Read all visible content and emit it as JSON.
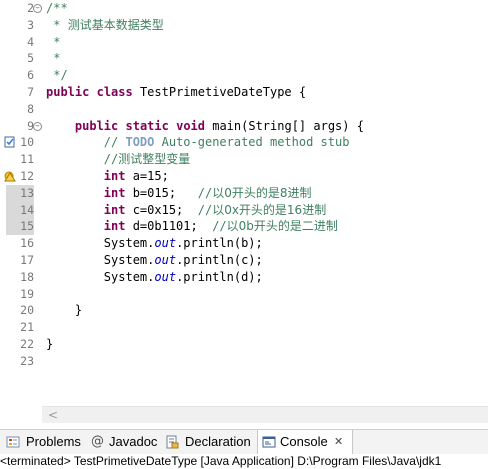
{
  "editor": {
    "lines": [
      {
        "no": "2",
        "fold": "−",
        "segs": [
          {
            "t": "/**",
            "c": "cm"
          }
        ]
      },
      {
        "no": "3",
        "segs": [
          {
            "t": " * ",
            "c": "cm"
          },
          {
            "t": "测试基本数据类型",
            "c": "cm cn"
          }
        ]
      },
      {
        "no": "4",
        "segs": [
          {
            "t": " *",
            "c": "cm"
          }
        ]
      },
      {
        "no": "5",
        "segs": [
          {
            "t": " *",
            "c": "cm"
          }
        ]
      },
      {
        "no": "6",
        "segs": [
          {
            "t": " */",
            "c": "cm"
          }
        ]
      },
      {
        "no": "7",
        "segs": [
          {
            "t": "public",
            "c": "kw"
          },
          {
            "t": " "
          },
          {
            "t": "class",
            "c": "kw"
          },
          {
            "t": " TestPrimetiveDateType {"
          }
        ]
      },
      {
        "no": "8",
        "segs": []
      },
      {
        "no": "9",
        "fold": "−",
        "segs": [
          {
            "t": "    "
          },
          {
            "t": "public",
            "c": "kw"
          },
          {
            "t": " "
          },
          {
            "t": "static",
            "c": "kw"
          },
          {
            "t": " "
          },
          {
            "t": "void",
            "c": "kw"
          },
          {
            "t": " main(String[] "
          },
          {
            "t": "args",
            "c": "plain"
          },
          {
            "t": ") {"
          }
        ]
      },
      {
        "no": "10",
        "marker": "task",
        "segs": [
          {
            "t": "        "
          },
          {
            "t": "// ",
            "c": "cm"
          },
          {
            "t": "TODO",
            "c": "todo"
          },
          {
            "t": " Auto-generated method stub",
            "c": "cm"
          }
        ]
      },
      {
        "no": "11",
        "segs": [
          {
            "t": "        "
          },
          {
            "t": "//",
            "c": "cm"
          },
          {
            "t": "测试整型变量",
            "c": "cm cn"
          }
        ]
      },
      {
        "no": "12",
        "marker": "warn",
        "segs": [
          {
            "t": "        "
          },
          {
            "t": "int",
            "c": "kw"
          },
          {
            "t": " a=15;"
          }
        ]
      },
      {
        "no": "13",
        "hl": true,
        "segs": [
          {
            "t": "        "
          },
          {
            "t": "int",
            "c": "kw"
          },
          {
            "t": " b=015;   "
          },
          {
            "t": "//",
            "c": "cm"
          },
          {
            "t": "以0开头的是8进制",
            "c": "cm cn"
          }
        ]
      },
      {
        "no": "14",
        "hl": true,
        "segs": [
          {
            "t": "        "
          },
          {
            "t": "int",
            "c": "kw"
          },
          {
            "t": " c=0x15;  "
          },
          {
            "t": "//",
            "c": "cm"
          },
          {
            "t": "以0x开头的是16进制",
            "c": "cm cn"
          }
        ]
      },
      {
        "no": "15",
        "hl": true,
        "segs": [
          {
            "t": "        "
          },
          {
            "t": "int",
            "c": "kw"
          },
          {
            "t": " d=0b1101;  "
          },
          {
            "t": "//",
            "c": "cm"
          },
          {
            "t": "以0b开头的是二进制",
            "c": "cm cn"
          }
        ]
      },
      {
        "no": "16",
        "segs": [
          {
            "t": "        System."
          },
          {
            "t": "out",
            "c": "fld"
          },
          {
            "t": ".println(b);"
          }
        ]
      },
      {
        "no": "17",
        "segs": [
          {
            "t": "        System."
          },
          {
            "t": "out",
            "c": "fld"
          },
          {
            "t": ".println(c);"
          }
        ]
      },
      {
        "no": "18",
        "segs": [
          {
            "t": "        System."
          },
          {
            "t": "out",
            "c": "fld"
          },
          {
            "t": ".println(d);"
          }
        ]
      },
      {
        "no": "19",
        "segs": []
      },
      {
        "no": "20",
        "segs": [
          {
            "t": "    }"
          }
        ]
      },
      {
        "no": "21",
        "segs": []
      },
      {
        "no": "22",
        "segs": [
          {
            "t": "}"
          }
        ]
      },
      {
        "no": "23",
        "segs": []
      }
    ],
    "scroll_left_arrow": "<"
  },
  "tabs": [
    {
      "label": "Problems",
      "icon": "problems-icon",
      "close": ""
    },
    {
      "label": "Javadoc",
      "icon": "at-icon",
      "close": ""
    },
    {
      "label": "Declaration",
      "icon": "declaration-icon",
      "close": ""
    },
    {
      "label": "Console",
      "icon": "console-icon",
      "close": "✕",
      "active": true
    }
  ],
  "status": {
    "text": "<terminated> TestPrimetiveDateType [Java Application] D:\\Program Files\\Java\\jdk1"
  },
  "colors": {
    "keyword": "#7f0055",
    "comment": "#3f7f5f",
    "todo": "#7f9fbf",
    "field": "#0000c0",
    "line_number": "#787878"
  }
}
